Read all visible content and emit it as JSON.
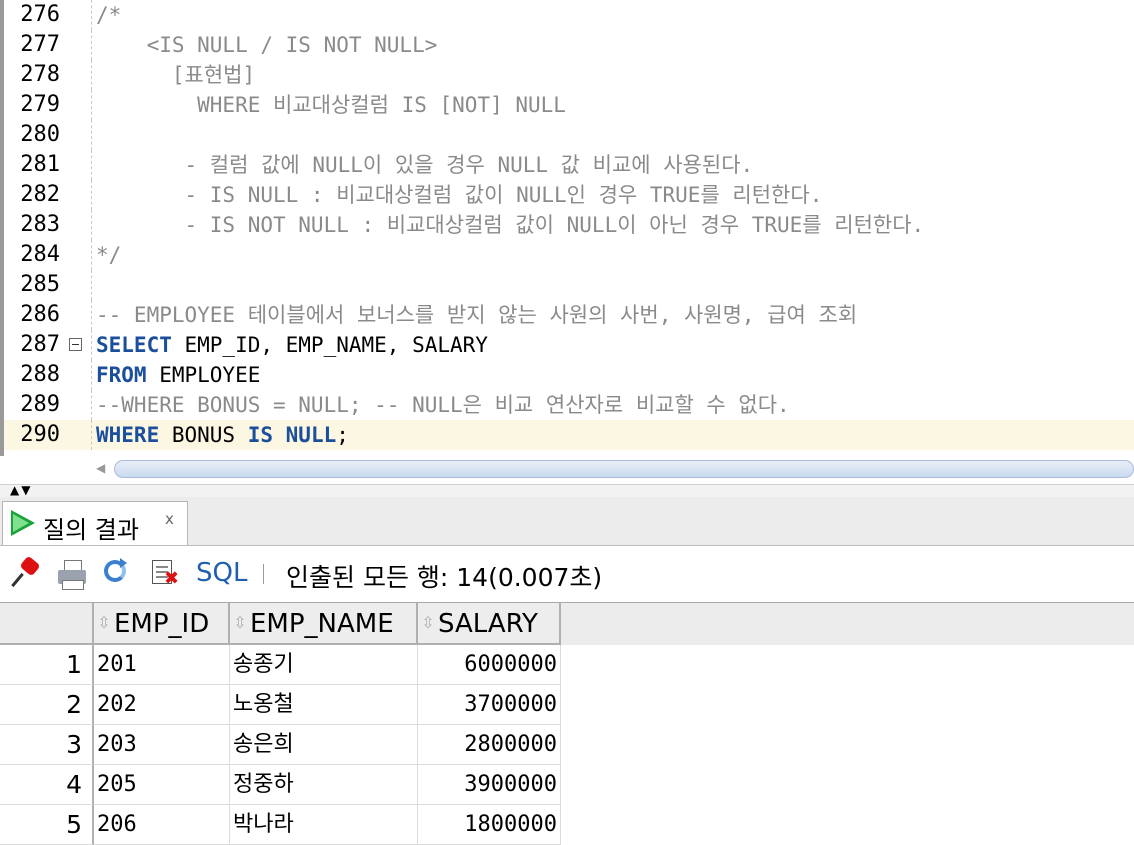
{
  "editor": {
    "lines": [
      {
        "no": "276",
        "parts": [
          {
            "t": "/*",
            "c": "cmt"
          }
        ]
      },
      {
        "no": "277",
        "parts": [
          {
            "t": "    <IS NULL / IS NOT NULL>",
            "c": "cmt"
          }
        ]
      },
      {
        "no": "278",
        "parts": [
          {
            "t": "      [표현법]",
            "c": "cmt"
          }
        ]
      },
      {
        "no": "279",
        "parts": [
          {
            "t": "        WHERE 비교대상컬럼 IS [NOT] NULL",
            "c": "cmt"
          }
        ]
      },
      {
        "no": "280",
        "parts": [
          {
            "t": "",
            "c": "cmt"
          }
        ]
      },
      {
        "no": "281",
        "parts": [
          {
            "t": "       - 컬럼 값에 NULL이 있을 경우 NULL 값 비교에 사용된다.",
            "c": "cmt"
          }
        ]
      },
      {
        "no": "282",
        "parts": [
          {
            "t": "       - IS NULL : 비교대상컬럼 값이 NULL인 경우 TRUE를 리턴한다.",
            "c": "cmt"
          }
        ]
      },
      {
        "no": "283",
        "parts": [
          {
            "t": "       - IS NOT NULL : 비교대상컬럼 값이 NULL이 아닌 경우 TRUE를 리턴한다.",
            "c": "cmt"
          }
        ]
      },
      {
        "no": "284",
        "parts": [
          {
            "t": "*/",
            "c": "cmt"
          }
        ]
      },
      {
        "no": "285",
        "parts": [
          {
            "t": "",
            "c": "cmt"
          }
        ]
      },
      {
        "no": "286",
        "parts": [
          {
            "t": "-- EMPLOYEE 테이블에서 보너스를 받지 않는 사원의 사번, 사원명, 급여 조회",
            "c": "cmt"
          }
        ]
      },
      {
        "no": "287",
        "fold": true,
        "parts": [
          {
            "t": "SELECT",
            "c": "kw"
          },
          {
            "t": " EMP_ID, EMP_NAME, SALARY",
            "c": ""
          }
        ]
      },
      {
        "no": "288",
        "parts": [
          {
            "t": "FROM",
            "c": "kw"
          },
          {
            "t": " EMPLOYEE",
            "c": ""
          }
        ]
      },
      {
        "no": "289",
        "parts": [
          {
            "t": "--WHERE BONUS = NULL; -- NULL은 비교 연산자로 비교할 수 없다.",
            "c": "cmt"
          }
        ]
      },
      {
        "no": "290",
        "current": true,
        "parts": [
          {
            "t": "WHERE",
            "c": "kw"
          },
          {
            "t": " BONUS ",
            "c": ""
          },
          {
            "t": "IS NULL",
            "c": "kw"
          },
          {
            "t": ";",
            "c": ""
          }
        ]
      }
    ]
  },
  "results_tab": {
    "label": "질의 결과",
    "close": "x"
  },
  "toolbar": {
    "icons": [
      "pin-icon",
      "print-icon",
      "refresh-icon",
      "delete-icon"
    ],
    "sql_label": "SQL",
    "status": "인출된 모든 행: 14(0.007초)"
  },
  "grid": {
    "columns": [
      "EMP_ID",
      "EMP_NAME",
      "SALARY"
    ],
    "rows": [
      {
        "n": "1",
        "EMP_ID": "201",
        "EMP_NAME": "송종기",
        "SALARY": "6000000"
      },
      {
        "n": "2",
        "EMP_ID": "202",
        "EMP_NAME": "노옹철",
        "SALARY": "3700000"
      },
      {
        "n": "3",
        "EMP_ID": "203",
        "EMP_NAME": "송은희",
        "SALARY": "2800000"
      },
      {
        "n": "4",
        "EMP_ID": "205",
        "EMP_NAME": "정중하",
        "SALARY": "3900000"
      },
      {
        "n": "5",
        "EMP_ID": "206",
        "EMP_NAME": "박나라",
        "SALARY": "1800000"
      }
    ]
  },
  "colors": {
    "keyword": "#1b4f9c",
    "comment": "#8a8a8a",
    "current_line": "#fbf7e3",
    "sql_link": "#1f5fb0"
  }
}
